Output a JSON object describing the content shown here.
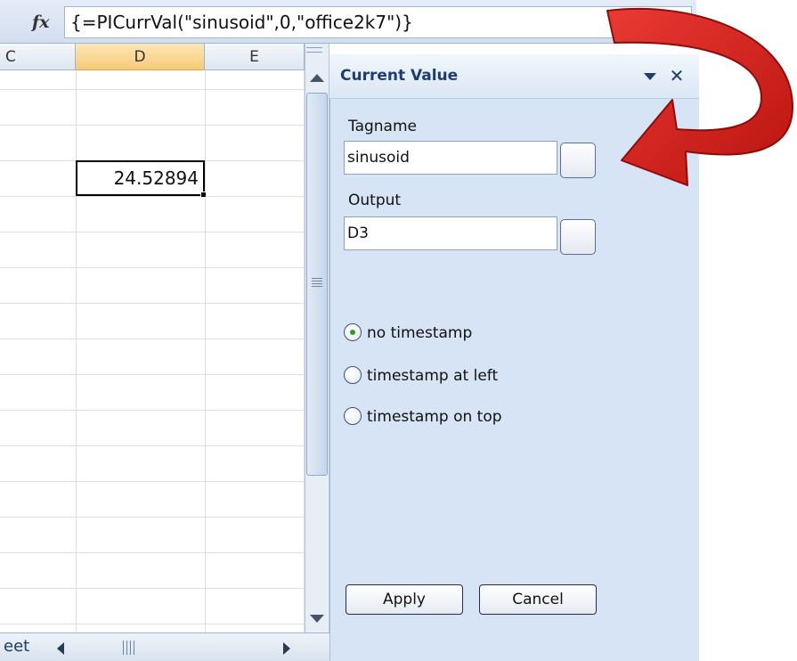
{
  "formula_bar": {
    "fx_icon": "fx",
    "formula": "{=PICurrVal(\"sinusoid\",0,\"office2k7\")}"
  },
  "sheet": {
    "columns": [
      "C",
      "D",
      "E"
    ],
    "active_cell_value": "24.52894",
    "sheet_tab_label": "eet"
  },
  "task_pane": {
    "title": "Current Value",
    "tagname_label": "Tagname",
    "tagname_value": "sinusoid",
    "output_label": "Output",
    "output_value": "D3",
    "timestamp_options": [
      {
        "label": "no timestamp",
        "selected": true
      },
      {
        "label": "timestamp at left",
        "selected": false
      },
      {
        "label": "timestamp on top",
        "selected": false
      }
    ],
    "apply_label": "Apply",
    "cancel_label": "Cancel"
  },
  "icons": {
    "pane_menu": "chevron-down-icon",
    "pane_close": "close-icon",
    "callout": "curved-red-arrow"
  },
  "colors": {
    "active_column_header": "#f6c978",
    "pane_background": "#d6e4f5",
    "pane_title": "#1c3d6e",
    "callout_arrow": "#d8231f",
    "radio_selected": "#2f9a2f"
  }
}
